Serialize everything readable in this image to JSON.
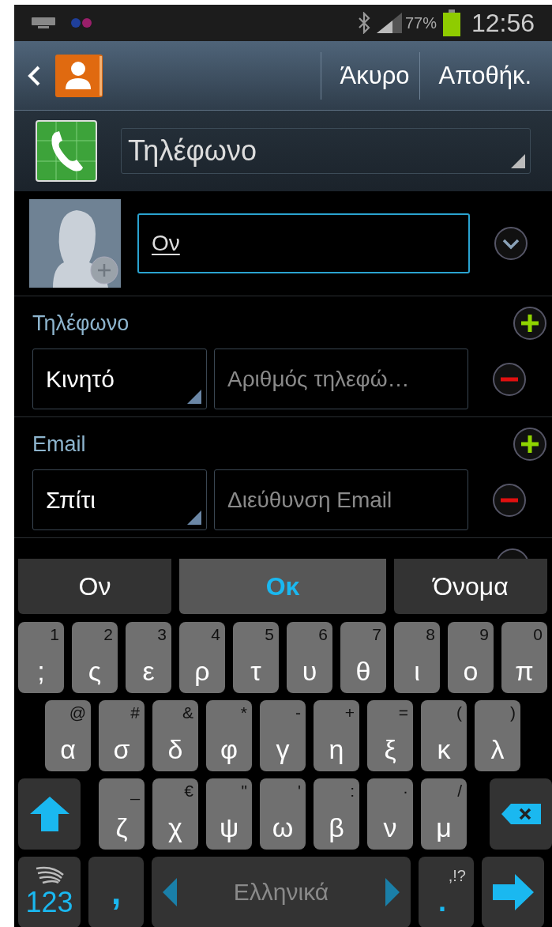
{
  "status_bar": {
    "battery": "77%",
    "time": "12:56"
  },
  "action_bar": {
    "buttons": [
      "Άκυρο",
      "Αποθήκ."
    ]
  },
  "account": {
    "value": "Τηλέφωνο"
  },
  "name_field": {
    "value": "Ον"
  },
  "sections": [
    {
      "title": "Τηλέφωνο",
      "type": "Κινητό",
      "placeholder": "Αριθμός τηλεφώ…"
    },
    {
      "title": "Email",
      "type": "Σπίτι",
      "placeholder": "Διεύθυνση Email"
    }
  ],
  "keyboard": {
    "suggestions": [
      {
        "text": "Ον",
        "selected": false
      },
      {
        "text": "Οκ",
        "selected": true
      },
      {
        "text": "Όνομα",
        "selected": false
      }
    ],
    "rows": [
      [
        {
          "main": ";",
          "hint": "1"
        },
        {
          "main": "ς",
          "hint": "2"
        },
        {
          "main": "ε",
          "hint": "3"
        },
        {
          "main": "ρ",
          "hint": "4"
        },
        {
          "main": "τ",
          "hint": "5"
        },
        {
          "main": "υ",
          "hint": "6"
        },
        {
          "main": "θ",
          "hint": "7"
        },
        {
          "main": "ι",
          "hint": "8"
        },
        {
          "main": "ο",
          "hint": "9"
        },
        {
          "main": "π",
          "hint": "0"
        }
      ],
      [
        {
          "main": "α",
          "hint": "@"
        },
        {
          "main": "σ",
          "hint": "#"
        },
        {
          "main": "δ",
          "hint": "&"
        },
        {
          "main": "φ",
          "hint": "*"
        },
        {
          "main": "γ",
          "hint": "-"
        },
        {
          "main": "η",
          "hint": "+"
        },
        {
          "main": "ξ",
          "hint": "="
        },
        {
          "main": "κ",
          "hint": "("
        },
        {
          "main": "λ",
          "hint": ")"
        }
      ],
      [
        {
          "main": "ζ",
          "hint": "_"
        },
        {
          "main": "χ",
          "hint": "€"
        },
        {
          "main": "ψ",
          "hint": "\""
        },
        {
          "main": "ω",
          "hint": "'"
        },
        {
          "main": "β",
          "hint": ":"
        },
        {
          "main": "ν",
          "hint": "·"
        },
        {
          "main": "μ",
          "hint": "/"
        }
      ]
    ],
    "symbols_key": "123",
    "comma_key": ",",
    "language": "Ελληνικά",
    "period_key": ".",
    "period_hint": ",!?"
  }
}
